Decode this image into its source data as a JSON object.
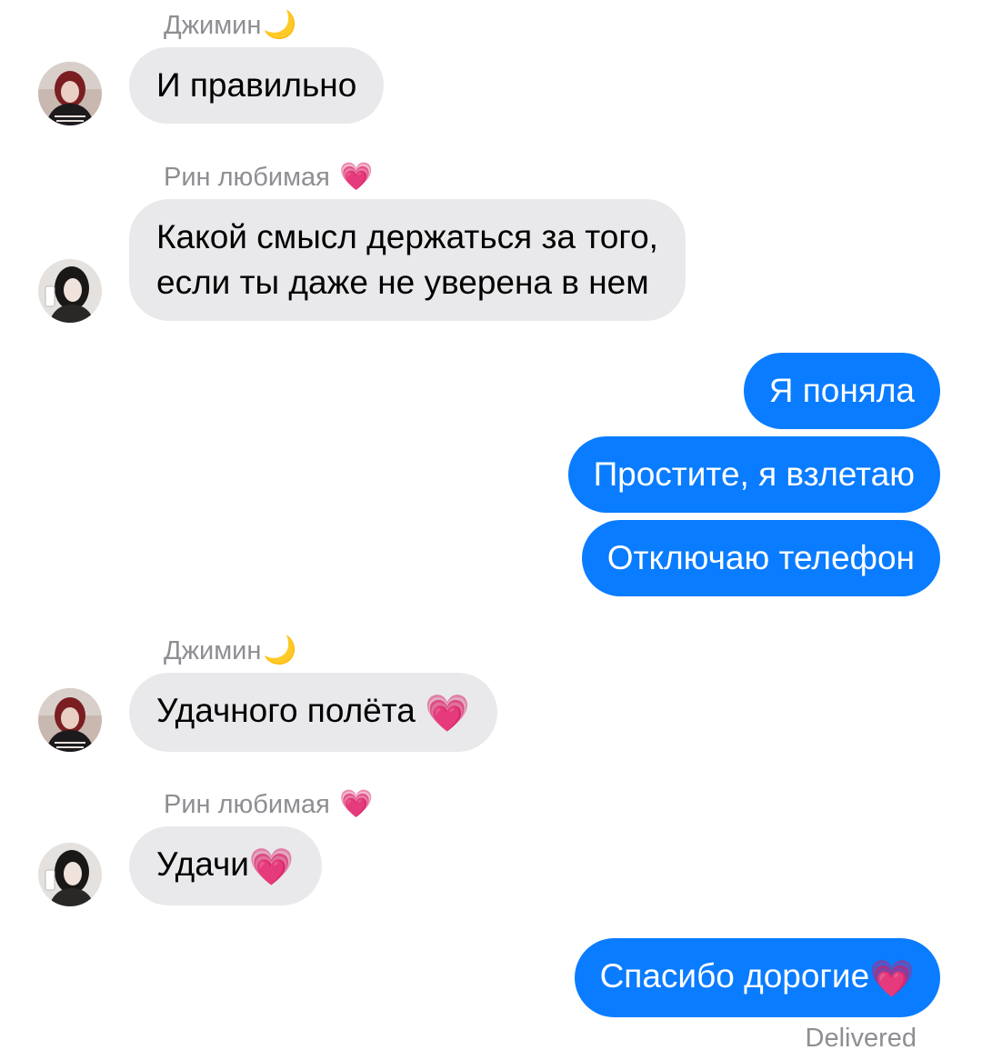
{
  "messages": [
    {
      "sender": "Джимин",
      "sender_emoji": "🌙",
      "text": "И правильно"
    },
    {
      "sender": "Рин любимая",
      "sender_emoji": "💗",
      "lines": [
        "Какой смысл держаться за того,",
        "если ты даже не уверена в нем"
      ]
    },
    {
      "text": "Я поняла"
    },
    {
      "text": "Простите, я взлетаю"
    },
    {
      "text": "Отключаю телефон"
    },
    {
      "sender": "Джимин",
      "sender_emoji": "🌙",
      "text": "Удачного полёта",
      "emoji": "💗"
    },
    {
      "sender": "Рин любимая",
      "sender_emoji": "💗",
      "text": "Удачи",
      "emoji": "💗"
    },
    {
      "text": "Спасибо дорогие",
      "emoji": "💗"
    }
  ],
  "status": "Delivered",
  "colors": {
    "incoming_bubble": "#e9e9eb",
    "outgoing_bubble": "#0a7cff",
    "sender_label": "#8e8e93"
  },
  "icons": {
    "moon": "crescent-moon-icon",
    "heart": "growing-heart-icon"
  }
}
